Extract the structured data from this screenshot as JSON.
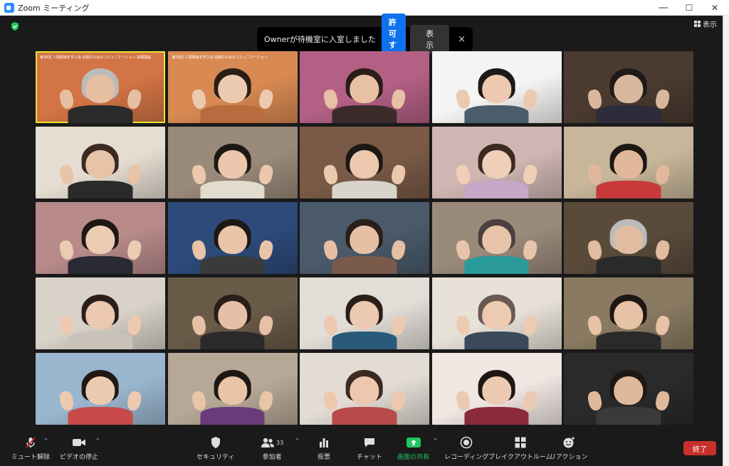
{
  "window": {
    "title": "Zoom ミーティング",
    "minimize": "—",
    "maximize": "☐",
    "close": "✕"
  },
  "header": {
    "view_label": "表示"
  },
  "notification": {
    "message": "Ownerが待機室に入室しました",
    "admit_label": "許可する",
    "see_label": "表示",
    "close_label": "×"
  },
  "tiles": [
    {
      "bg": "#d27445",
      "shirt": "#2a2a2a",
      "hair": "#bbbbbb",
      "skin": "#e6bfa1",
      "active": true,
      "slide": "第39回 人間関係を学ぶ会 信頼のためのコミュニケーション 基礎講座"
    },
    {
      "bg": "#d98a52",
      "shirt": "#b86b3e",
      "hair": "#2a1e18",
      "skin": "#eccab0",
      "active": false,
      "slide": "第39回 人間関係を学ぶ会 信頼のためのコミュニケーション"
    },
    {
      "bg": "#b36084",
      "shirt": "#3b2b2b",
      "hair": "#2a1e18",
      "skin": "#e8c0a4",
      "active": false,
      "slide": ""
    },
    {
      "bg": "#f4f4f2",
      "shirt": "#4b5c6a",
      "hair": "#1e1a18",
      "skin": "#ecc9b0",
      "active": false,
      "slide": ""
    },
    {
      "bg": "#4a3a30",
      "shirt": "#2c2c3a",
      "hair": "#1e1a18",
      "skin": "#d9b79c",
      "active": false,
      "slide": ""
    },
    {
      "bg": "#e6ddd2",
      "shirt": "#2a2a2a",
      "hair": "#3a2a22",
      "skin": "#e7c3a7",
      "active": false,
      "slide": ""
    },
    {
      "bg": "#9a8a7a",
      "shirt": "#e2dccf",
      "hair": "#1e1814",
      "skin": "#ebc7ad",
      "active": false,
      "slide": ""
    },
    {
      "bg": "#7a5a46",
      "shirt": "#d8d4cc",
      "hair": "#1e1814",
      "skin": "#ebc8ae",
      "active": false,
      "slide": ""
    },
    {
      "bg": "#cfb6b2",
      "shirt": "#c8a6c8",
      "hair": "#3a2a20",
      "skin": "#efcfb8",
      "active": false,
      "slide": ""
    },
    {
      "bg": "#c8b69a",
      "shirt": "#c83a3a",
      "hair": "#1e1814",
      "skin": "#e2b89c",
      "active": false,
      "slide": ""
    },
    {
      "bg": "#b88a8a",
      "shirt": "#2a2a34",
      "hair": "#1e1814",
      "skin": "#eccbb3",
      "active": false,
      "slide": ""
    },
    {
      "bg": "#2d4a7a",
      "shirt": "#3a3a3a",
      "hair": "#1e1814",
      "skin": "#e9c4a8",
      "active": false,
      "slide": ""
    },
    {
      "bg": "#4a5a6a",
      "shirt": "#7a5a4a",
      "hair": "#2a1e18",
      "skin": "#e6c0a4",
      "active": false,
      "slide": ""
    },
    {
      "bg": "#9a8a7a",
      "shirt": "#2a9a9a",
      "hair": "#4a4040",
      "skin": "#e8c5aa",
      "active": false,
      "slide": ""
    },
    {
      "bg": "#5a4a3a",
      "shirt": "#2a2a2a",
      "hair": "#bbbbbb",
      "skin": "#e2bca0",
      "active": false,
      "slide": ""
    },
    {
      "bg": "#d8d2c8",
      "shirt": "#c9c2b8",
      "hair": "#2a1e18",
      "skin": "#ecc9b0",
      "active": false,
      "slide": ""
    },
    {
      "bg": "#6a5a48",
      "shirt": "#2a2a2a",
      "hair": "#2a1e18",
      "skin": "#e6c0a6",
      "active": false,
      "slide": ""
    },
    {
      "bg": "#e2ddd6",
      "shirt": "#2a5a7a",
      "hair": "#2a1e18",
      "skin": "#eccab2",
      "active": false,
      "slide": ""
    },
    {
      "bg": "#e7e1d8",
      "shirt": "#3a4a5a",
      "hair": "#6a5a54",
      "skin": "#eccbb2",
      "active": false,
      "slide": ""
    },
    {
      "bg": "#8a7a62",
      "shirt": "#2a2a2a",
      "hair": "#1e1814",
      "skin": "#e6c2a6",
      "active": false,
      "slide": ""
    },
    {
      "bg": "#9ab6cf",
      "shirt": "#c84a4a",
      "hair": "#1e1814",
      "skin": "#eccab0",
      "active": false,
      "slide": ""
    },
    {
      "bg": "#b6a896",
      "shirt": "#6a3a7a",
      "hair": "#1e1814",
      "skin": "#e8c4a8",
      "active": false,
      "slide": ""
    },
    {
      "bg": "#e2dcd4",
      "shirt": "#b84a4a",
      "hair": "#3a2a20",
      "skin": "#ecc8ae",
      "active": false,
      "slide": ""
    },
    {
      "bg": "#f0e6e2",
      "shirt": "#8a2a3a",
      "hair": "#1e1814",
      "skin": "#eccab2",
      "active": false,
      "slide": ""
    },
    {
      "bg": "#2a2a2a",
      "shirt": "#3a3a3a",
      "hair": "#1e1814",
      "skin": "#e0b89a",
      "active": false,
      "slide": ""
    }
  ],
  "toolbar": {
    "mute": "ミュート解除",
    "video": "ビデオの停止",
    "security": "セキュリティ",
    "participants": "参加者",
    "participants_count": "33",
    "polling": "投票",
    "chat": "チャット",
    "share": "画面の共有",
    "record": "レコーディング",
    "breakout": "ブレイクアウトルーム",
    "reactions": "リアクション",
    "end": "終了"
  },
  "colors": {
    "accent": "#0e72ed",
    "share_green": "#22c55e",
    "end_red": "#c9302c",
    "active_speaker": "#e6e62e"
  }
}
